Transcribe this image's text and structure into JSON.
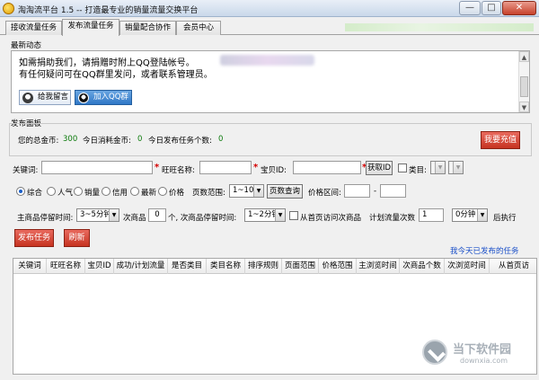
{
  "window": {
    "title": "淘淘流平台 1.5 -- 打造最专业的销量流量交换平台",
    "buttons": {
      "minimize": "—",
      "maximize": "□",
      "close": "✕"
    }
  },
  "tabs": [
    {
      "label": "接收流量任务"
    },
    {
      "label": "发布流量任务"
    },
    {
      "label": "销量配合协作"
    },
    {
      "label": "会员中心"
    }
  ],
  "news": {
    "label": "最新动态",
    "line1": "如需捐助我们，请捐赠时附上QQ登陆帐号。",
    "line2": "有任何疑问可在QQ群里发问，或者联系管理员。",
    "btn_message": "给我留言",
    "btn_qq": "加入QQ群"
  },
  "panel": {
    "label": "发布面板",
    "total_coins_label": "您的总金币:",
    "total_coins": "300",
    "today_spent_label": "今日消耗金币:",
    "today_spent": "0",
    "today_tasks_label": "今日发布任务个数:",
    "today_tasks": "0",
    "recharge": "我要充值"
  },
  "form": {
    "keyword_label": "关键词:",
    "wangwang_label": "旺旺名称:",
    "item_id_label": "宝贝ID:",
    "get_id_btn": "获取ID",
    "category_label": "类目:",
    "sort_options": [
      "综合",
      "人气",
      "销量",
      "信用",
      "最新",
      "价格"
    ],
    "page_range_label": "页数范围:",
    "page_range_value": "1~10",
    "page_query_btn": "页数查询",
    "price_range_label": "价格区间:",
    "price_sep": "-",
    "main_stay_label": "主商品停留时间:",
    "main_stay_value": "3~5分钟",
    "sub_item_label": "次商品",
    "sub_count": "0",
    "sub_stay_label": "个, 次商品停留时间:",
    "sub_stay_value": "1~2分钟",
    "from_home_label": "从首页访问次商品",
    "plan_times_label": "计划流量次数",
    "plan_times": "1",
    "delay_value": "0分钟",
    "after_exec_label": "后执行",
    "publish_btn": "发布任务",
    "refresh_btn": "刷新",
    "today_tasks_link": "我今天已发布的任务"
  },
  "table": {
    "columns": [
      "关键词",
      "旺旺名称",
      "宝贝ID",
      "成功/计划流量",
      "是否类目",
      "类目名称",
      "排序规则",
      "页面范围",
      "价格范围",
      "主浏览时间",
      "次商品个数",
      "次浏览时间",
      "从首页访"
    ]
  },
  "watermark": {
    "title": "当下软件园",
    "url": "downxia.com"
  }
}
